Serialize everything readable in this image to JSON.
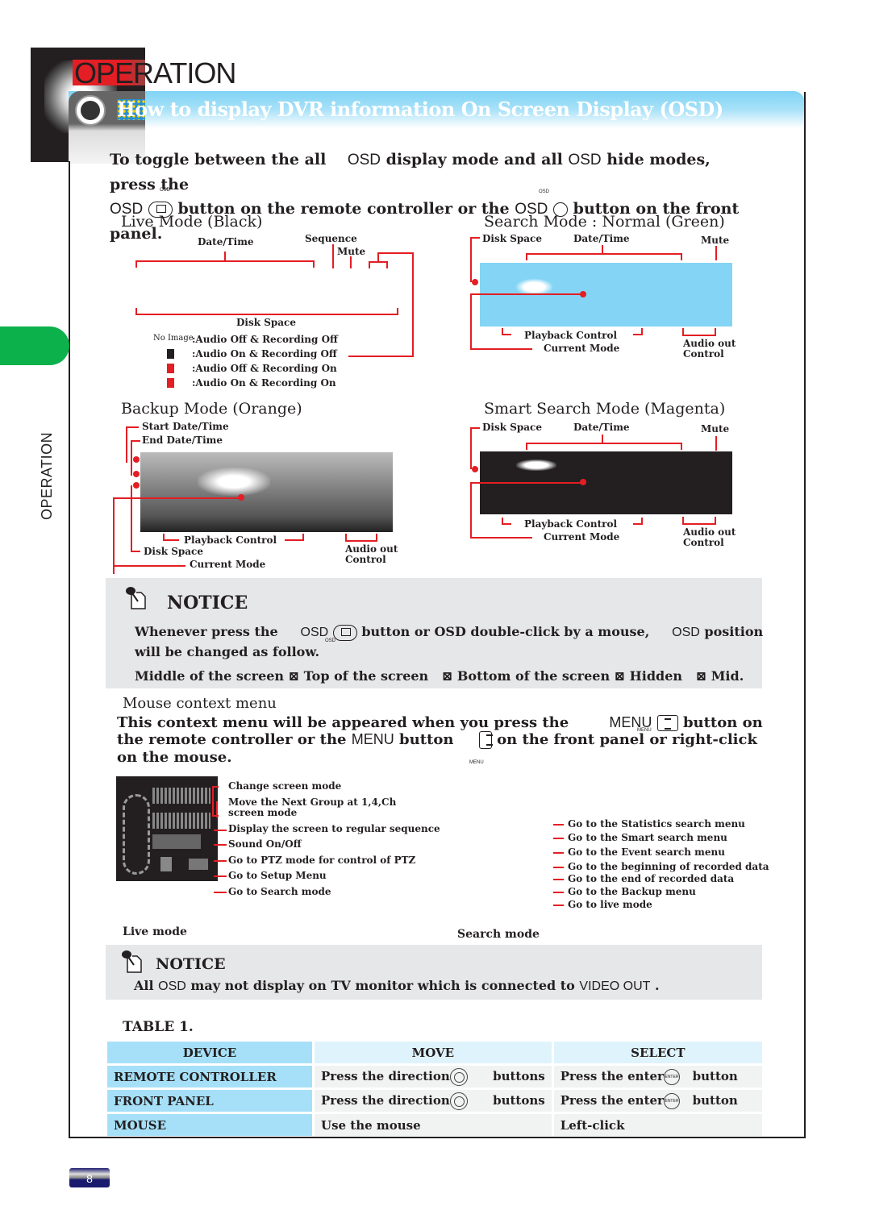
{
  "header": {
    "section_title": "OPERATION",
    "banner_title": "How to display DVR information On Screen Display (OSD)"
  },
  "side_tab": {
    "label": "OPERATION",
    "color": "#0db14b"
  },
  "intro": {
    "line1_a": "To toggle between the all",
    "line1_osd": "OSD",
    "line1_b": "display mode and all",
    "line1_osd2": "OSD",
    "line1_c": "hide modes, press the",
    "line2_osd": "OSD",
    "line2_icon_label": "OSD",
    "line2_a": "button on the remote controller or the",
    "line2_osd2": "OSD",
    "line2_icon2_label": "OSD",
    "line2_b": "button on the front panel."
  },
  "live_mode": {
    "title": "Live Mode (Black)",
    "labels": {
      "datetime": "Date/Time",
      "sequence": "Sequence",
      "mute": "Mute",
      "disk_space": "Disk Space"
    },
    "legend": [
      {
        "icon": "No Image",
        "text": ":Audio Off & Recording Off"
      },
      {
        "icon": "speaker-black-icon",
        "text": ":Audio On & Recording Off"
      },
      {
        "icon": "speaker-red-icon",
        "text": ":Audio Off & Recording On"
      },
      {
        "icon": "speaker-red-sound-icon",
        "text": ":Audio On & Recording On"
      }
    ]
  },
  "search_mode": {
    "title": "Search Mode : Normal (Green)",
    "labels": {
      "disk_space": "Disk Space",
      "datetime": "Date/Time",
      "mute": "Mute",
      "playback": "Playback Control",
      "current_mode": "Current Mode",
      "audio_out": "Audio out",
      "control": "Control"
    }
  },
  "backup_mode": {
    "title": "Backup Mode (Orange)",
    "labels": {
      "start": "Start Date/Time",
      "end": "End Date/Time",
      "playback": "Playback Control",
      "disk_space": "Disk Space",
      "current_mode": "Current Mode",
      "audio_out": "Audio out",
      "control": "Control"
    }
  },
  "smart_mode": {
    "title": "Smart Search Mode (Magenta)",
    "labels": {
      "disk_space": "Disk Space",
      "datetime": "Date/Time",
      "mute": "Mute",
      "playback": "Playback Control",
      "current_mode": "Current Mode",
      "audio_out": "Audio out",
      "control": "Control"
    }
  },
  "notice1": {
    "title": "NOTICE",
    "line1_a": "Whenever press the",
    "line1_osd": "OSD",
    "icon_label": "OSD",
    "line1_b": "button or OSD double-click by a mouse,",
    "line1_osd2": "OSD",
    "line1_c": "position",
    "line2": "will be changed as follow.",
    "sequence": [
      "Middle of the screen",
      "Top of the screen",
      "Bottom of the screen",
      "Hidden",
      "Mid."
    ]
  },
  "context_menu": {
    "heading": "Mouse context menu",
    "line1_a": "This context menu will be appeared when you press the",
    "line1_menu": "MENU",
    "line1_b": "button on",
    "line2_a": "the remote controller or the",
    "line2_menu": "MENU",
    "line2_b": "button",
    "line2_c": "on the front panel or right-click",
    "line3": "on the mouse.",
    "icon_label": "MENU",
    "live_items": [
      "Change screen mode",
      "Move the Next Group at 1,4,Ch",
      "screen mode",
      "Display the screen to regular sequence",
      "Sound On/Off",
      "Go to PTZ mode for control of PTZ",
      "Go to Setup Menu",
      "Go to Search mode"
    ],
    "search_items": [
      "Go to the Statistics search menu",
      "Go to the Smart search menu",
      "Go to the Event search menu",
      "Go to the beginning of recorded data",
      "Go to the end of recorded data",
      "Go to the Backup menu",
      "Go to live mode"
    ],
    "live_caption": "Live mode",
    "search_caption": "Search mode"
  },
  "notice2": {
    "title": "NOTICE",
    "text_a": "All",
    "text_osd": "OSD",
    "text_b": "may not display on TV monitor which is connected to",
    "text_video": "VIDEO OUT",
    "text_c": "."
  },
  "table": {
    "caption": "TABLE 1.",
    "headers": [
      "DEVICE",
      "MOVE",
      "SELECT"
    ],
    "rows": [
      {
        "device": "REMOTE CONTROLLER",
        "move_a": "Press the direction",
        "move_b": "buttons",
        "select_a": "Press the enter",
        "select_b": "button",
        "enter_label": "ENTER"
      },
      {
        "device": "FRONT PANEL",
        "move_a": "Press the direction",
        "move_b": "buttons",
        "select_a": "Press the enter",
        "select_b": "button",
        "enter_label": "ENTER"
      },
      {
        "device": "MOUSE",
        "move_a": "Use the mouse",
        "select_a": "Left-click"
      }
    ]
  },
  "footer": {
    "page_number": "8"
  }
}
